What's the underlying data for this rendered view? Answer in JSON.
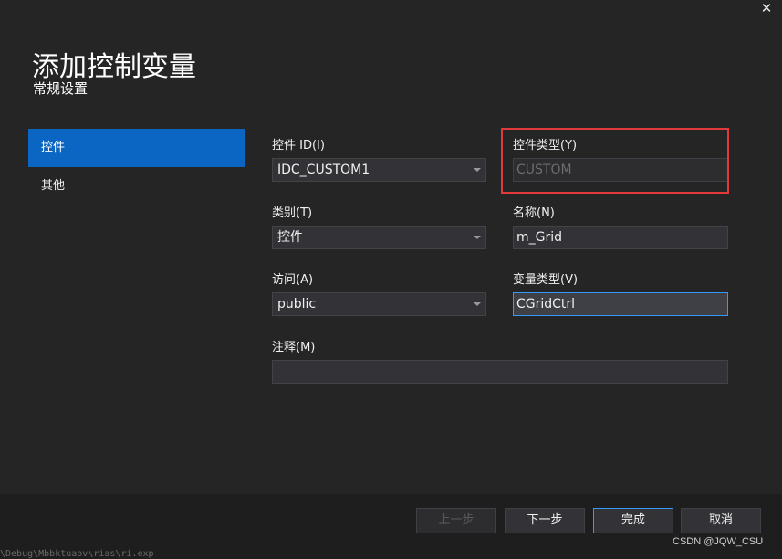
{
  "dialog": {
    "title": "添加控制变量",
    "subtitle": "常规设置",
    "close_icon": "close-icon"
  },
  "nav": {
    "items": [
      {
        "label": "控件",
        "active": true
      },
      {
        "label": "其他",
        "active": false
      }
    ]
  },
  "form": {
    "control_id": {
      "label": "控件 ID(I)",
      "value": "IDC_CUSTOM1"
    },
    "control_type": {
      "label": "控件类型(Y)",
      "value": "CUSTOM"
    },
    "category": {
      "label": "类别(T)",
      "value": "控件"
    },
    "name": {
      "label": "名称(N)",
      "value": "m_Grid"
    },
    "access": {
      "label": "访问(A)",
      "value": "public"
    },
    "var_type": {
      "label": "变量类型(V)",
      "value": "CGridCtrl"
    },
    "comment": {
      "label": "注释(M)",
      "value": ""
    }
  },
  "buttons": {
    "prev": "上一步",
    "next": "下一步",
    "finish": "完成",
    "cancel": "取消"
  },
  "overlay": {
    "watermark": "CSDN @JQW_CSU",
    "background_text": "\\Debug\\Mbbktuaov\\rias\\ri.exp"
  },
  "colors": {
    "accent": "#0a66c2",
    "focus_border": "#3399ff",
    "highlight_box": "#e03a3a"
  }
}
